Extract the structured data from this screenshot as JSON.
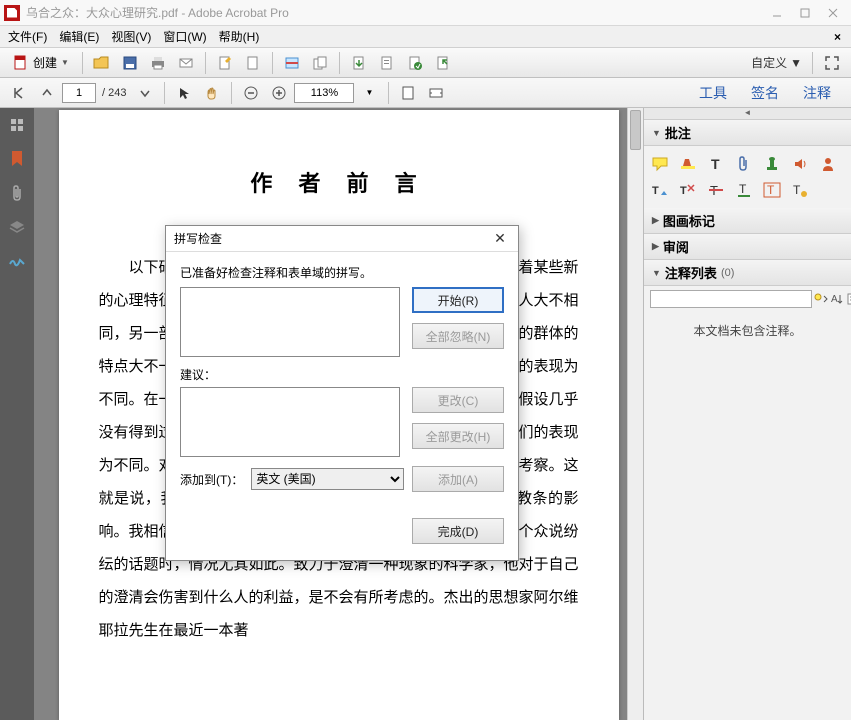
{
  "window": {
    "title": "乌合之众：大众心理研究.pdf - Adobe Acrobat Pro"
  },
  "menu": {
    "file": "文件(F)",
    "edit": "编辑(E)",
    "view": "视图(V)",
    "window": "窗口(W)",
    "help": "帮助(H)"
  },
  "toolbar1": {
    "create": "创建",
    "customize": "自定义"
  },
  "toolbar2": {
    "page_current": "1",
    "page_total": "/ 243",
    "zoom": "113%"
  },
  "rightlinks": {
    "tools": "工具",
    "sign": "签名",
    "annotate": "注释"
  },
  "panels": {
    "annotation_hdr": "批注",
    "drawing_hdr": "图画标记",
    "review_hdr": "审阅",
    "annlist_hdr": "注释列表",
    "annlist_count": "(0)",
    "no_annotations": "本文档未包含注释。"
  },
  "document": {
    "heading": "作 者 前 言",
    "body": "以下研究是为了描述群体的特征加在一起的时候，其中存在着某些新的心理特征加在一起的时候，其中存在着某些新的心理特征加分人大不相同，另一部分人则与之非常相似。一部起这个联合中的人所形成的群体的特点大不一样。他们还表现出群体所形成的特殊心理，因此他们的表现为不同。在一些历史记载中，这个假设有着惊人的力量。然而这种假设几乎没有得到过系统的研究。这也就是为什么了个人的心理，因此他们的表现为不同。对于这些群体心理所形成的群体心理，心理学家进行了考察。这就是说，我的努力只有方法上的考虑，不受各种意见、理论和教条的影响。我相信，这是发现少许真理的惟一办法，当这里所讨论的是个众说纷纭的话题时，情况尤其如此。致力于澄清一种现象的科学家，他对于自己的澄清会伤害到什么人的利益，是不会有所考虑的。杰出的思想家阿尔维耶拉先生在最近一本著"
  },
  "dialog": {
    "title": "拼写检查",
    "desc": "已准备好检查注释和表单域的拼写。",
    "suggestion_label": "建议：",
    "addto_label": "添加到(T)：",
    "lang_selected": "英文 (美国)",
    "btn_start": "开始(R)",
    "btn_ignore_all": "全部忽略(N)",
    "btn_change": "更改(C)",
    "btn_change_all": "全部更改(H)",
    "btn_add": "添加(A)",
    "btn_done": "完成(D)"
  }
}
